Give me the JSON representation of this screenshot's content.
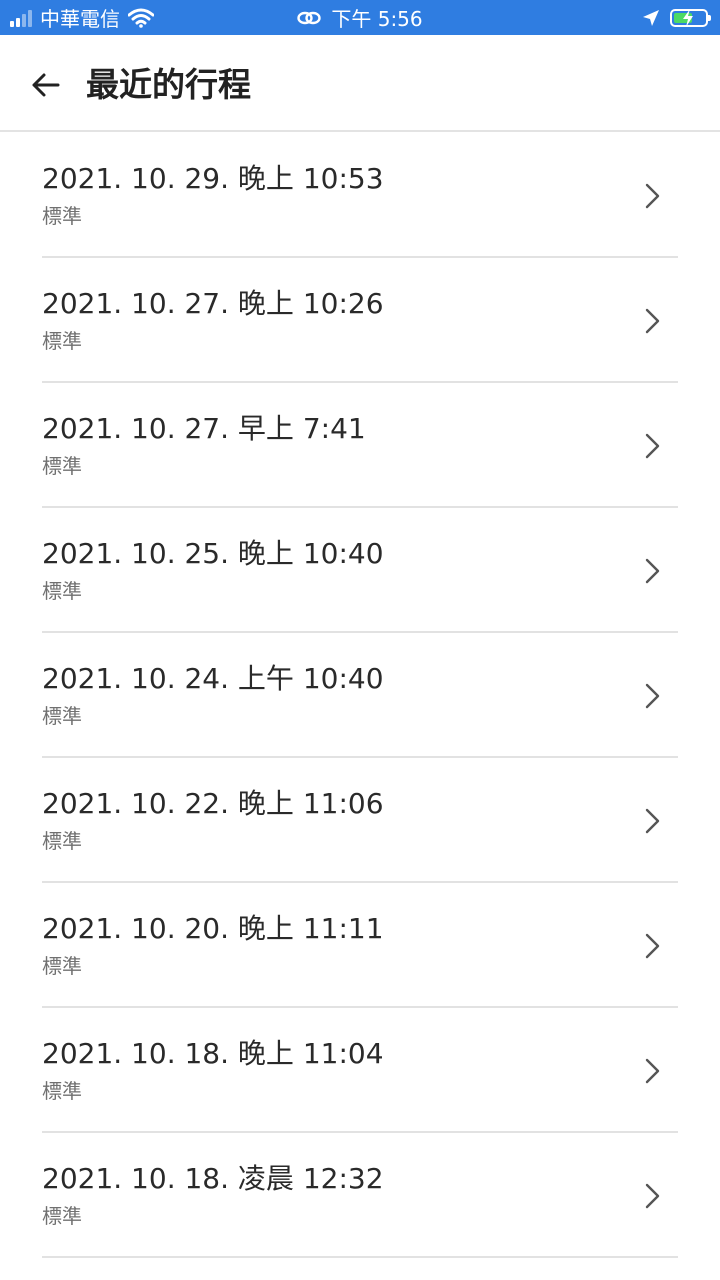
{
  "status_bar": {
    "carrier": "中華電信",
    "time": "下午 5:56",
    "accent_color": "#2f7de1"
  },
  "header": {
    "title": "最近的行程",
    "back_icon": "arrow-left-icon"
  },
  "trips": [
    {
      "title": "2021. 10. 29. 晚上 10:53",
      "subtitle": "標準"
    },
    {
      "title": "2021. 10. 27. 晚上 10:26",
      "subtitle": "標準"
    },
    {
      "title": "2021. 10. 27. 早上 7:41",
      "subtitle": "標準"
    },
    {
      "title": "2021. 10. 25. 晚上 10:40",
      "subtitle": "標準"
    },
    {
      "title": "2021. 10. 24. 上午 10:40",
      "subtitle": "標準"
    },
    {
      "title": "2021. 10. 22. 晚上 11:06",
      "subtitle": "標準"
    },
    {
      "title": "2021. 10. 20. 晚上 11:11",
      "subtitle": "標準"
    },
    {
      "title": "2021. 10. 18. 晚上 11:04",
      "subtitle": "標準"
    },
    {
      "title": "2021. 10. 18. 凌晨 12:32",
      "subtitle": "標準"
    }
  ],
  "icons": {
    "row_chevron": "chevron-right-icon"
  }
}
